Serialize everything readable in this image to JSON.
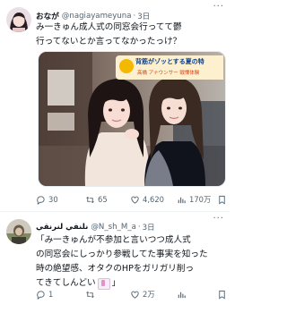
{
  "tweet1": {
    "display_name": "おなが",
    "handle": "@nagiayameyuna",
    "separator": "·",
    "time": "3日",
    "line1": "み一きゅん成人式の同窓会行ってて鬱",
    "line2": "行ってないとか言ってなかったっけ？",
    "media_banner_main": "背筋がゾッとする夏の特",
    "media_banner_sub": "髙橋 アナウンサー 戦慄体験",
    "actions": {
      "reply": "30",
      "retweet": "65",
      "like": "4,620",
      "views": "170万"
    }
  },
  "tweet2": {
    "display_name": "ﻧﻠﻨﻔﻲ ﻟﻨﺮﻧﻘﻲ",
    "handle": "@N_sh_M_a",
    "separator": "·",
    "time": "3日",
    "line1": "「み一きゅんが不参加と言いつつ成人式",
    "line2": "の同窓会にしっかり参戦してた事実を知った",
    "line3": "時の絶望感、オタクのHPをガリガリ削っ",
    "line4": "てきてしんどい",
    "line4_tail": "」",
    "actions": {
      "reply": "1",
      "retweet": "",
      "like": "2万",
      "views": ""
    }
  },
  "colors": {
    "text": "#0f1419",
    "secondary": "#536471",
    "divider": "#eff3f4",
    "banner_bg": "#fdf0cf"
  }
}
